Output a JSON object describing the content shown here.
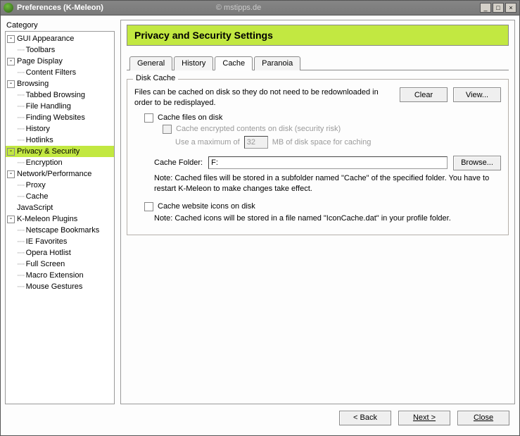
{
  "title": "Preferences (K-Meleon)",
  "watermark": "© mstipps.de",
  "sidebar": {
    "heading": "Category",
    "items": [
      {
        "label": "GUI Appearance",
        "depth": 0,
        "exp": true
      },
      {
        "label": "Toolbars",
        "depth": 1
      },
      {
        "label": "Page Display",
        "depth": 0,
        "exp": true
      },
      {
        "label": "Content Filters",
        "depth": 1
      },
      {
        "label": "Browsing",
        "depth": 0,
        "exp": true
      },
      {
        "label": "Tabbed Browsing",
        "depth": 1
      },
      {
        "label": "File Handling",
        "depth": 1
      },
      {
        "label": "Finding Websites",
        "depth": 1
      },
      {
        "label": "History",
        "depth": 1
      },
      {
        "label": "Hotlinks",
        "depth": 1
      },
      {
        "label": "Privacy & Security",
        "depth": 0,
        "exp": true,
        "selected": true
      },
      {
        "label": "Encryption",
        "depth": 1
      },
      {
        "label": "Network/Performance",
        "depth": 0,
        "exp": true
      },
      {
        "label": "Proxy",
        "depth": 1
      },
      {
        "label": "Cache",
        "depth": 1
      },
      {
        "label": "JavaScript",
        "depth": 0
      },
      {
        "label": "K-Meleon Plugins",
        "depth": 0,
        "exp": true
      },
      {
        "label": "Netscape Bookmarks",
        "depth": 1
      },
      {
        "label": "IE Favorites",
        "depth": 1
      },
      {
        "label": "Opera Hotlist",
        "depth": 1
      },
      {
        "label": "Full Screen",
        "depth": 1
      },
      {
        "label": "Macro Extension",
        "depth": 1
      },
      {
        "label": "Mouse Gestures",
        "depth": 1
      }
    ]
  },
  "panel": {
    "heading": "Privacy and Security Settings",
    "tabs": [
      "General",
      "History",
      "Cache",
      "Paranoia"
    ],
    "active_tab": 2,
    "group_title": "Disk Cache",
    "desc": "Files can be cached on disk so they do not need to be redownloaded in order to be redisplayed.",
    "clear_btn": "Clear",
    "view_btn": "View...",
    "chk_cache_files": "Cache files on disk",
    "chk_cache_enc": "Cache encrypted contents on disk (security risk)",
    "max_prefix": "Use a maximum of",
    "max_value": "32",
    "max_suffix": "MB of disk space for caching",
    "folder_label": "Cache Folder:",
    "folder_value": "F:",
    "browse_btn": "Browse...",
    "folder_note": "Note: Cached files will be stored in a subfolder named \"Cache\" of the specified folder. You have to restart K-Meleon to make changes take effect.",
    "chk_icons": "Cache website icons on disk",
    "icons_note": "Note: Cached icons will be stored in a file named \"IconCache.dat\" in your profile folder."
  },
  "footer": {
    "back": "< Back",
    "next": "Next >",
    "close": "Close"
  }
}
